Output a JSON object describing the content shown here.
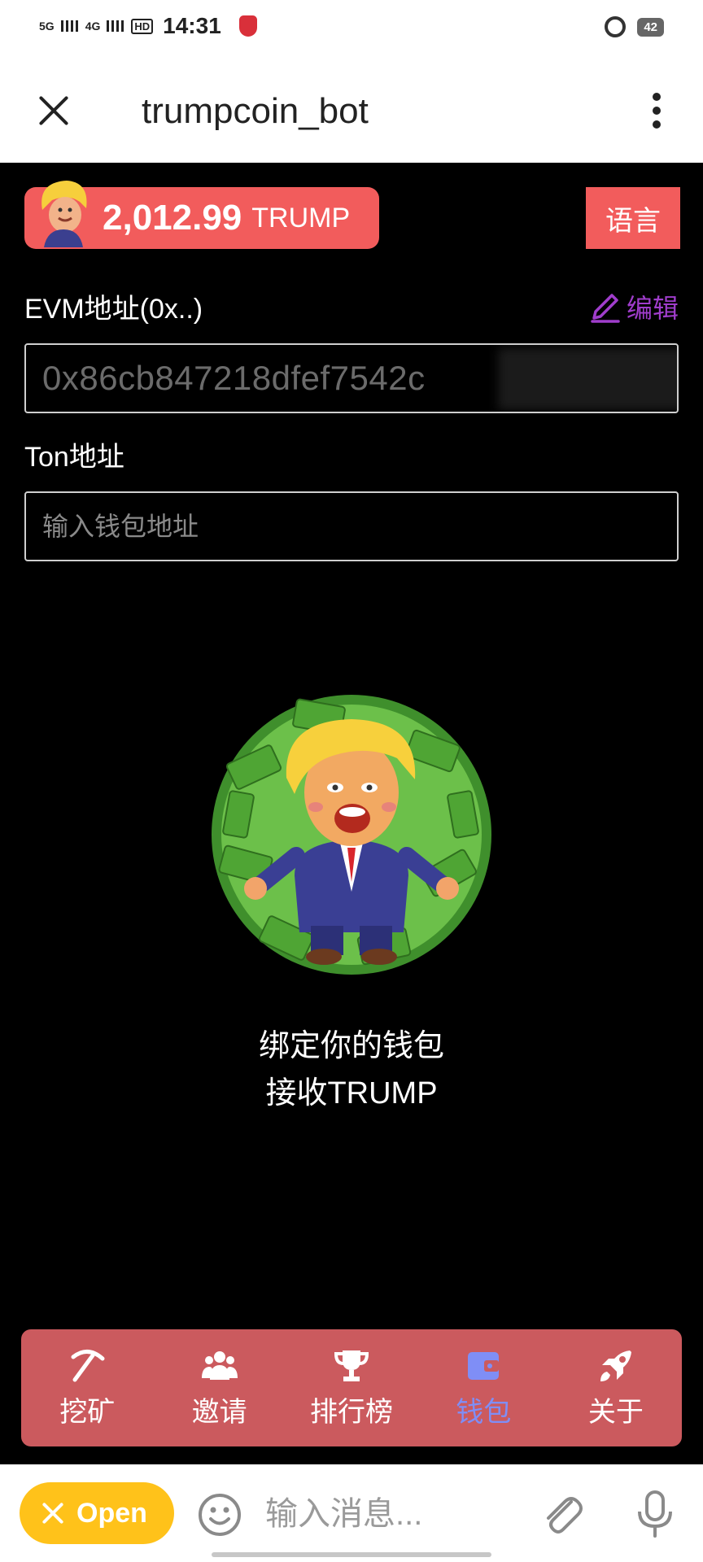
{
  "status_bar": {
    "signal_1": "5G",
    "signal_2": "4G",
    "hd_label": "HD",
    "time": "14:31",
    "battery": "42"
  },
  "header": {
    "title": "trumpcoin_bot"
  },
  "balance": {
    "amount": "2,012.99",
    "unit": "TRUMP"
  },
  "language_button": "语言",
  "evm": {
    "label": "EVM地址(0x..)",
    "edit_label": "编辑",
    "value": "0x86cb847218dfef7542c"
  },
  "ton": {
    "label": "Ton地址",
    "placeholder": "输入钱包地址"
  },
  "message": {
    "line1": "绑定你的钱包",
    "line2": "接收TRUMP"
  },
  "tabs": [
    {
      "label": "挖矿",
      "icon": "pickaxe-icon"
    },
    {
      "label": "邀请",
      "icon": "users-icon"
    },
    {
      "label": "排行榜",
      "icon": "trophy-icon"
    },
    {
      "label": "钱包",
      "icon": "wallet-icon",
      "active": true
    },
    {
      "label": "关于",
      "icon": "rocket-icon"
    }
  ],
  "input_bar": {
    "open_label": "Open",
    "placeholder": "输入消息..."
  },
  "colors": {
    "accent_red": "#f25c5c",
    "tabbar": "#cb5a5e",
    "active_tab": "#7f8ef6",
    "edit_purple": "#a03dcc",
    "open_yellow": "#ffc21a"
  }
}
